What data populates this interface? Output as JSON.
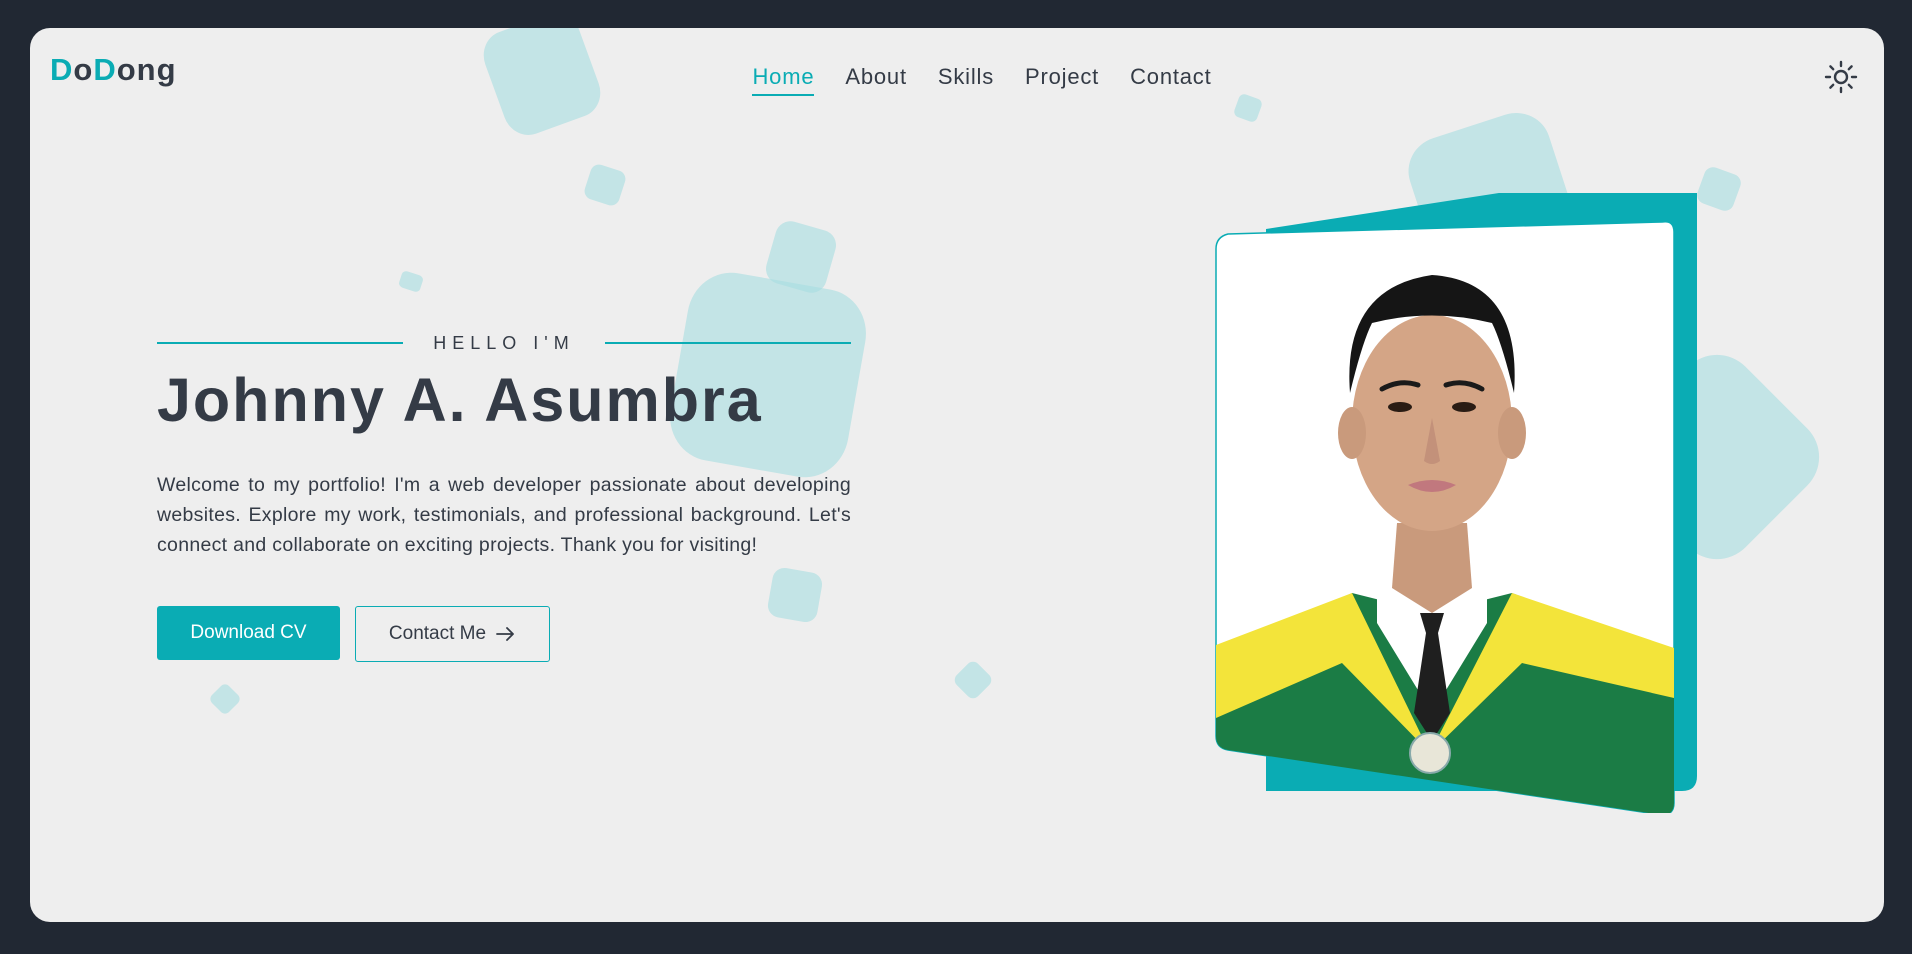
{
  "logo": {
    "part1": "D",
    "part2": "o",
    "part3": "D",
    "part4": "ong"
  },
  "nav": {
    "items": [
      {
        "label": "Home",
        "active": true
      },
      {
        "label": "About",
        "active": false
      },
      {
        "label": "Skills",
        "active": false
      },
      {
        "label": "Project",
        "active": false
      },
      {
        "label": "Contact",
        "active": false
      }
    ]
  },
  "theme_toggle": {
    "icon": "sun-icon"
  },
  "hero": {
    "greeting": "HELLO I'M",
    "name": "Johnny A. Asumbra",
    "description": "Welcome to my portfolio! I'm a web developer passionate about developing websites. Explore my work, testimonials, and professional background. Let's connect and collaborate on exciting projects. Thank you for visiting!",
    "primary_button": "Download CV",
    "secondary_button": "Contact Me",
    "secondary_icon": "arrow-right-icon"
  },
  "colors": {
    "accent": "#0aacb4",
    "text": "#343b46",
    "background": "#eeeeee",
    "outer": "#212833",
    "shape": "#a8dde0"
  }
}
